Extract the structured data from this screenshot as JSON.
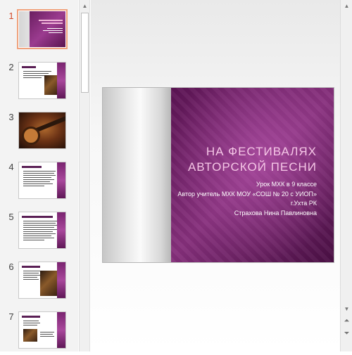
{
  "thumbnails": [
    {
      "number": "1",
      "active": true
    },
    {
      "number": "2",
      "active": false
    },
    {
      "number": "3",
      "active": false
    },
    {
      "number": "4",
      "active": false
    },
    {
      "number": "5",
      "active": false
    },
    {
      "number": "6",
      "active": false
    },
    {
      "number": "7",
      "active": false
    }
  ],
  "slide": {
    "title": "НА ФЕСТИВАЛЯХ АВТОРСКОЙ ПЕСНИ",
    "line1": "Урок МХК в 9 классе",
    "line2": "Автор учитель МХК МОУ «СОШ № 20 с УИОП» г.Ухта РК",
    "line3": "Страхова Нина Павлиновна"
  },
  "icons": {
    "scroll_up": "triangle-up-icon",
    "scroll_down": "triangle-down-icon",
    "prev_slide": "double-chevron-up-icon",
    "next_slide": "double-chevron-down-icon"
  },
  "colors": {
    "accent": "#d24726",
    "slide_purple": "#86307c",
    "title_pink": "#f5c6e6"
  }
}
